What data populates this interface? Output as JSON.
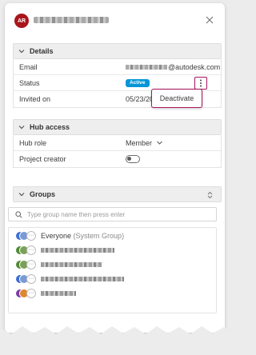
{
  "header": {
    "avatar_initials": "AR",
    "avatar_color": "#a8161c"
  },
  "details": {
    "title": "Details",
    "email_label": "Email",
    "email_domain": "@autodesk.com",
    "status_label": "Status",
    "status_value": "Active",
    "status_color": "#0696d7",
    "invited_label": "Invited on",
    "invited_value": "05/23/2025",
    "menu_item": "Deactivate",
    "focus_color": "#a3165d"
  },
  "hub_access": {
    "title": "Hub access",
    "role_label": "Hub role",
    "role_value": "Member",
    "creator_label": "Project creator",
    "creator_enabled": false
  },
  "groups": {
    "title": "Groups",
    "search_placeholder": "Type group name then press enter",
    "items": [
      {
        "name": "Everyone",
        "suffix": "(System Group)",
        "colors": [
          "#3b6fd6",
          "#7a9ad6"
        ]
      },
      {
        "name": "",
        "suffix": "",
        "colors": [
          "#4f8a32",
          "#7aa05a"
        ]
      },
      {
        "name": "",
        "suffix": "",
        "colors": [
          "#4f8a32",
          "#7aa05a"
        ]
      },
      {
        "name": "",
        "suffix": "",
        "colors": [
          "#3b6fd6",
          "#7a9ad6"
        ]
      },
      {
        "name": "",
        "suffix": "",
        "colors": [
          "#7a3ea8",
          "#e0862e"
        ]
      }
    ]
  },
  "icons": {
    "close": "close-icon",
    "section_chevron": "chevron-down-icon",
    "more": "more-vertical-icon",
    "role_chevron": "chevron-down-icon",
    "sort": "sort-icon",
    "search": "search-icon"
  }
}
